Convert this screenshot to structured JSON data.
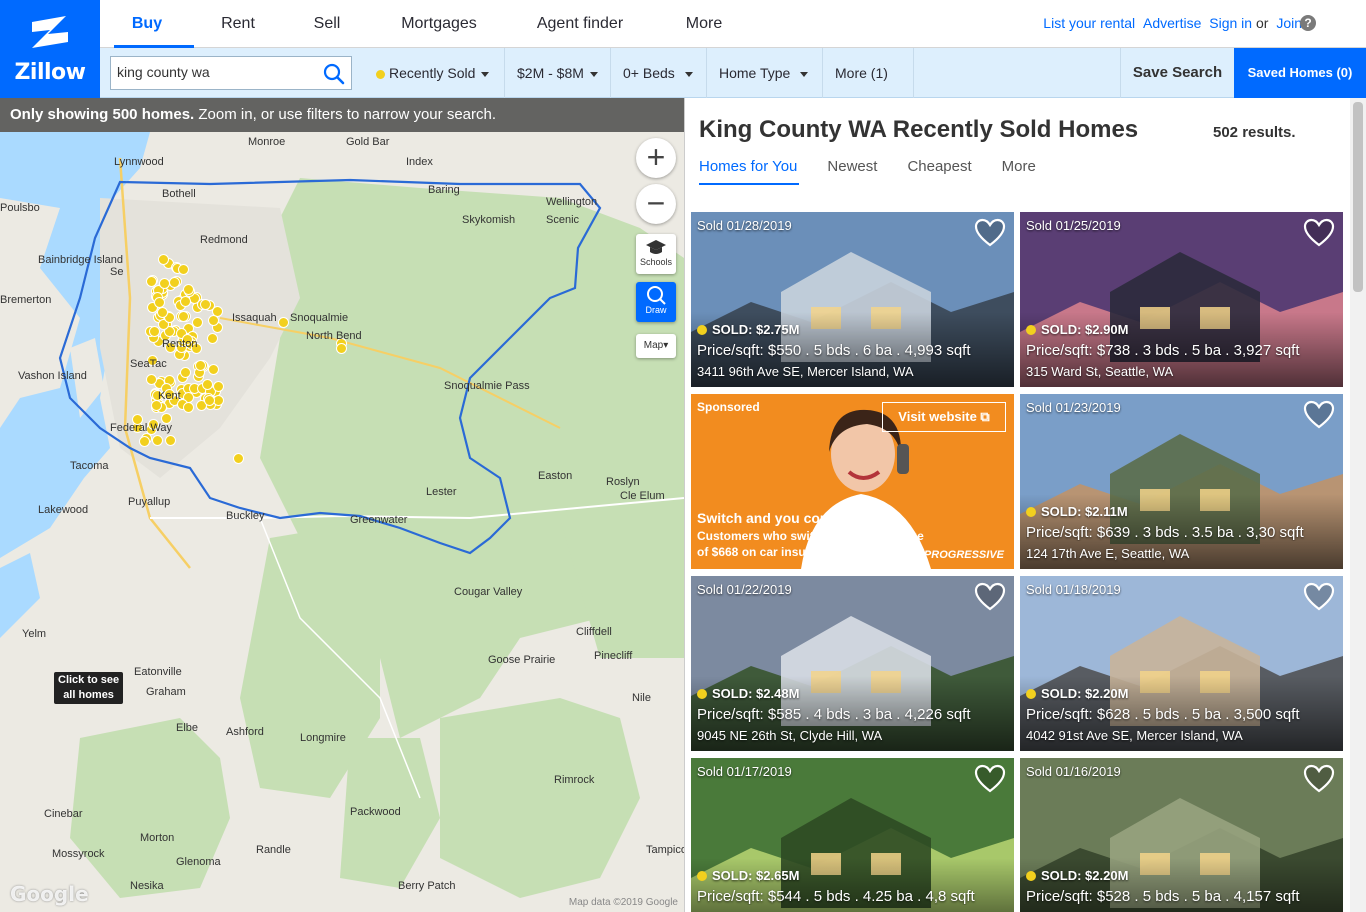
{
  "brand": {
    "name": "Zillow"
  },
  "nav": [
    "Buy",
    "Rent",
    "Sell",
    "Mortgages",
    "Agent finder",
    "More"
  ],
  "top_links": {
    "list_rental": "List your rental",
    "advertise": "Advertise",
    "sign_in": "Sign in",
    "or": "or",
    "join": "Join",
    "help": "?"
  },
  "search": {
    "value": "king county wa"
  },
  "filters": {
    "status": "Recently Sold",
    "price": "$2M - $8M",
    "beds": "0+ Beds",
    "home_type": "Home Type",
    "more": "More (1)"
  },
  "save_search": "Save Search",
  "saved_homes": "Saved Homes (0)",
  "map": {
    "banner_bold": "Only showing 500 homes.",
    "banner_rest": "Zoom in, or use filters to narrow your search.",
    "schools": "Schools",
    "draw": "Draw",
    "map_type": "Map",
    "click_to_see_1": "Click to see",
    "click_to_see_2": "all homes",
    "google": "Google",
    "map_data": "Map data ©2019 Google",
    "places": [
      "Lynnwood",
      "Monroe",
      "Gold Bar",
      "Index",
      "Bothell",
      "Baring",
      "Wellington",
      "Skykomish",
      "Scenic",
      "Poulsbo",
      "Bainbridge Island",
      "Bremerton",
      "Se",
      "Snoqualmie",
      "North Bend",
      "Renton",
      "SeaTac",
      "Vashon Island",
      "Snoqualmie Pass",
      "Kent",
      "Federal Way",
      "Tacoma",
      "Easton",
      "Roslyn",
      "Cle Elum",
      "Lester",
      "Puyallup",
      "Lakewood",
      "Buckley",
      "Greenwater",
      "Cougar Valley",
      "Cliffdell",
      "Goose Prairie",
      "Pinecliff",
      "Yelm",
      "Eatonville",
      "Graham",
      "Nile",
      "Elbe",
      "Ashford",
      "Longmire",
      "Rimrock",
      "Cinebar",
      "Packwood",
      "Morton",
      "Mossyrock",
      "Randle",
      "Glenoma",
      "Tampico",
      "Nesika",
      "Berry Patch",
      "Issaquah",
      "Redmond"
    ]
  },
  "panel": {
    "title": "King County WA Recently Sold Homes",
    "results": "502 results.",
    "tabs": [
      "Homes for You",
      "Newest",
      "Cheapest",
      "More"
    ]
  },
  "listings": [
    {
      "sold_date": "Sold 01/28/2019",
      "status": "SOLD: $2.75M",
      "facts": "Price/sqft: $550 . 5 bds . 6 ba . 4,993 sqft",
      "address": "3411 96th Ave SE, Mercer Island, WA"
    },
    {
      "sold_date": "Sold 01/25/2019",
      "status": "SOLD: $2.90M",
      "facts": "Price/sqft: $738 . 3 bds . 5 ba . 3,927 sqft",
      "address": "315 Ward St, Seattle, WA"
    },
    {
      "sold_date": "Sold 01/23/2019",
      "status": "SOLD: $2.11M",
      "facts": "Price/sqft: $639 . 3 bds . 3.5 ba . 3,30 sqft",
      "address": "124 17th Ave E, Seattle, WA"
    },
    {
      "sold_date": "Sold 01/22/2019",
      "status": "SOLD: $2.48M",
      "facts": "Price/sqft: $585 . 4 bds . 3 ba . 4,226 sqft",
      "address": "9045 NE 26th St, Clyde Hill, WA"
    },
    {
      "sold_date": "Sold 01/18/2019",
      "status": "SOLD: $2.20M",
      "facts": "Price/sqft: $628 . 5 bds . 5 ba . 3,500 sqft",
      "address": "4042 91st Ave SE, Mercer Island, WA"
    },
    {
      "sold_date": "Sold 01/17/2019",
      "status": "SOLD: $2.65M",
      "facts": "Price/sqft: $544 . 5 bds . 4.25 ba . 4,8 sqft",
      "address": ""
    },
    {
      "sold_date": "Sold 01/16/2019",
      "status": "SOLD: $2.20M",
      "facts": "Price/sqft: $528 . 5 bds . 5 ba . 4,157 sqft",
      "address": ""
    }
  ],
  "ad": {
    "sponsored": "Sponsored",
    "visit": "Visit website",
    "headline": "Switch and you could save",
    "sub": "Customers who switch save an average of $668 on car insurance.",
    "brand": "PROGRESSIVE"
  }
}
